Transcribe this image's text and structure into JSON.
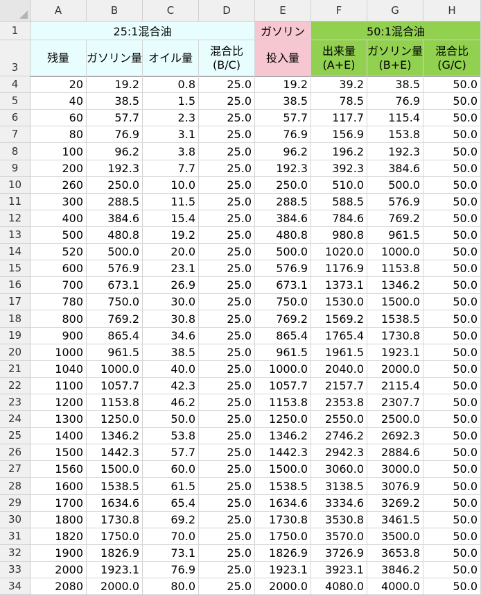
{
  "columns": [
    "A",
    "B",
    "C",
    "D",
    "E",
    "F",
    "G",
    "H"
  ],
  "header_rows": [
    "1",
    "3"
  ],
  "group_headers": {
    "mix25": "25:1混合油",
    "gasoline": "ガソリン",
    "mix50": "50:1混合油"
  },
  "field_headers": {
    "A": "残量",
    "B": "ガソリン量",
    "C": "オイル量",
    "D_line1": "混合比",
    "D_line2": "(B/C)",
    "E": "投入量",
    "F_line1": "出来量",
    "F_line2": "(A+E)",
    "G_line1": "ガソリン量",
    "G_line2": "(B+E)",
    "H_line1": "混合比",
    "H_line2": "(G/C)"
  },
  "colors": {
    "mix25_bg": "#e8fdfd",
    "gasoline_bg": "#f6c6d1",
    "mix50_bg": "#92d050"
  },
  "rows": [
    {
      "row": "4",
      "A": "20",
      "B": "19.2",
      "C": "0.8",
      "D": "25.0",
      "E": "19.2",
      "F": "39.2",
      "G": "38.5",
      "H": "50.0"
    },
    {
      "row": "5",
      "A": "40",
      "B": "38.5",
      "C": "1.5",
      "D": "25.0",
      "E": "38.5",
      "F": "78.5",
      "G": "76.9",
      "H": "50.0"
    },
    {
      "row": "6",
      "A": "60",
      "B": "57.7",
      "C": "2.3",
      "D": "25.0",
      "E": "57.7",
      "F": "117.7",
      "G": "115.4",
      "H": "50.0"
    },
    {
      "row": "7",
      "A": "80",
      "B": "76.9",
      "C": "3.1",
      "D": "25.0",
      "E": "76.9",
      "F": "156.9",
      "G": "153.8",
      "H": "50.0"
    },
    {
      "row": "8",
      "A": "100",
      "B": "96.2",
      "C": "3.8",
      "D": "25.0",
      "E": "96.2",
      "F": "196.2",
      "G": "192.3",
      "H": "50.0"
    },
    {
      "row": "9",
      "A": "200",
      "B": "192.3",
      "C": "7.7",
      "D": "25.0",
      "E": "192.3",
      "F": "392.3",
      "G": "384.6",
      "H": "50.0"
    },
    {
      "row": "10",
      "A": "260",
      "B": "250.0",
      "C": "10.0",
      "D": "25.0",
      "E": "250.0",
      "F": "510.0",
      "G": "500.0",
      "H": "50.0"
    },
    {
      "row": "11",
      "A": "300",
      "B": "288.5",
      "C": "11.5",
      "D": "25.0",
      "E": "288.5",
      "F": "588.5",
      "G": "576.9",
      "H": "50.0"
    },
    {
      "row": "12",
      "A": "400",
      "B": "384.6",
      "C": "15.4",
      "D": "25.0",
      "E": "384.6",
      "F": "784.6",
      "G": "769.2",
      "H": "50.0"
    },
    {
      "row": "13",
      "A": "500",
      "B": "480.8",
      "C": "19.2",
      "D": "25.0",
      "E": "480.8",
      "F": "980.8",
      "G": "961.5",
      "H": "50.0"
    },
    {
      "row": "14",
      "A": "520",
      "B": "500.0",
      "C": "20.0",
      "D": "25.0",
      "E": "500.0",
      "F": "1020.0",
      "G": "1000.0",
      "H": "50.0"
    },
    {
      "row": "15",
      "A": "600",
      "B": "576.9",
      "C": "23.1",
      "D": "25.0",
      "E": "576.9",
      "F": "1176.9",
      "G": "1153.8",
      "H": "50.0"
    },
    {
      "row": "16",
      "A": "700",
      "B": "673.1",
      "C": "26.9",
      "D": "25.0",
      "E": "673.1",
      "F": "1373.1",
      "G": "1346.2",
      "H": "50.0"
    },
    {
      "row": "17",
      "A": "780",
      "B": "750.0",
      "C": "30.0",
      "D": "25.0",
      "E": "750.0",
      "F": "1530.0",
      "G": "1500.0",
      "H": "50.0"
    },
    {
      "row": "18",
      "A": "800",
      "B": "769.2",
      "C": "30.8",
      "D": "25.0",
      "E": "769.2",
      "F": "1569.2",
      "G": "1538.5",
      "H": "50.0"
    },
    {
      "row": "19",
      "A": "900",
      "B": "865.4",
      "C": "34.6",
      "D": "25.0",
      "E": "865.4",
      "F": "1765.4",
      "G": "1730.8",
      "H": "50.0"
    },
    {
      "row": "20",
      "A": "1000",
      "B": "961.5",
      "C": "38.5",
      "D": "25.0",
      "E": "961.5",
      "F": "1961.5",
      "G": "1923.1",
      "H": "50.0"
    },
    {
      "row": "21",
      "A": "1040",
      "B": "1000.0",
      "C": "40.0",
      "D": "25.0",
      "E": "1000.0",
      "F": "2040.0",
      "G": "2000.0",
      "H": "50.0"
    },
    {
      "row": "22",
      "A": "1100",
      "B": "1057.7",
      "C": "42.3",
      "D": "25.0",
      "E": "1057.7",
      "F": "2157.7",
      "G": "2115.4",
      "H": "50.0"
    },
    {
      "row": "23",
      "A": "1200",
      "B": "1153.8",
      "C": "46.2",
      "D": "25.0",
      "E": "1153.8",
      "F": "2353.8",
      "G": "2307.7",
      "H": "50.0"
    },
    {
      "row": "24",
      "A": "1300",
      "B": "1250.0",
      "C": "50.0",
      "D": "25.0",
      "E": "1250.0",
      "F": "2550.0",
      "G": "2500.0",
      "H": "50.0"
    },
    {
      "row": "25",
      "A": "1400",
      "B": "1346.2",
      "C": "53.8",
      "D": "25.0",
      "E": "1346.2",
      "F": "2746.2",
      "G": "2692.3",
      "H": "50.0"
    },
    {
      "row": "26",
      "A": "1500",
      "B": "1442.3",
      "C": "57.7",
      "D": "25.0",
      "E": "1442.3",
      "F": "2942.3",
      "G": "2884.6",
      "H": "50.0"
    },
    {
      "row": "27",
      "A": "1560",
      "B": "1500.0",
      "C": "60.0",
      "D": "25.0",
      "E": "1500.0",
      "F": "3060.0",
      "G": "3000.0",
      "H": "50.0"
    },
    {
      "row": "28",
      "A": "1600",
      "B": "1538.5",
      "C": "61.5",
      "D": "25.0",
      "E": "1538.5",
      "F": "3138.5",
      "G": "3076.9",
      "H": "50.0"
    },
    {
      "row": "29",
      "A": "1700",
      "B": "1634.6",
      "C": "65.4",
      "D": "25.0",
      "E": "1634.6",
      "F": "3334.6",
      "G": "3269.2",
      "H": "50.0"
    },
    {
      "row": "30",
      "A": "1800",
      "B": "1730.8",
      "C": "69.2",
      "D": "25.0",
      "E": "1730.8",
      "F": "3530.8",
      "G": "3461.5",
      "H": "50.0"
    },
    {
      "row": "31",
      "A": "1820",
      "B": "1750.0",
      "C": "70.0",
      "D": "25.0",
      "E": "1750.0",
      "F": "3570.0",
      "G": "3500.0",
      "H": "50.0"
    },
    {
      "row": "32",
      "A": "1900",
      "B": "1826.9",
      "C": "73.1",
      "D": "25.0",
      "E": "1826.9",
      "F": "3726.9",
      "G": "3653.8",
      "H": "50.0"
    },
    {
      "row": "33",
      "A": "2000",
      "B": "1923.1",
      "C": "76.9",
      "D": "25.0",
      "E": "1923.1",
      "F": "3923.1",
      "G": "3846.2",
      "H": "50.0"
    },
    {
      "row": "34",
      "A": "2080",
      "B": "2000.0",
      "C": "80.0",
      "D": "25.0",
      "E": "2000.0",
      "F": "4080.0",
      "G": "4000.0",
      "H": "50.0"
    }
  ]
}
